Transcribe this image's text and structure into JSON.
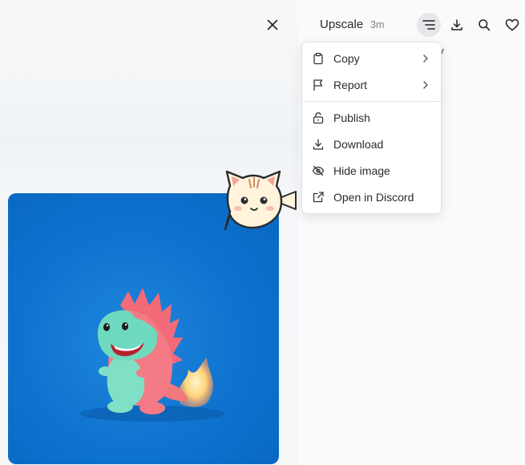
{
  "header": {
    "title": "Upscale",
    "time": "3m"
  },
  "behind": {
    "partial_text": "py"
  },
  "menu": {
    "items": [
      {
        "label": "Copy",
        "icon": "clipboard-icon",
        "has_submenu": true
      },
      {
        "label": "Report",
        "icon": "flag-icon",
        "has_submenu": true
      },
      {
        "label": "Publish",
        "icon": "lock-open-icon",
        "has_submenu": false
      },
      {
        "label": "Download",
        "icon": "download-icon",
        "has_submenu": false
      },
      {
        "label": "Hide image",
        "icon": "eye-off-icon",
        "has_submenu": false
      },
      {
        "label": "Open in Discord",
        "icon": "external-link-icon",
        "has_submenu": false
      }
    ]
  },
  "colors": {
    "image_background": "#0d72cf",
    "menu_background": "#ffffff",
    "active_button": "#e6e7ea"
  }
}
